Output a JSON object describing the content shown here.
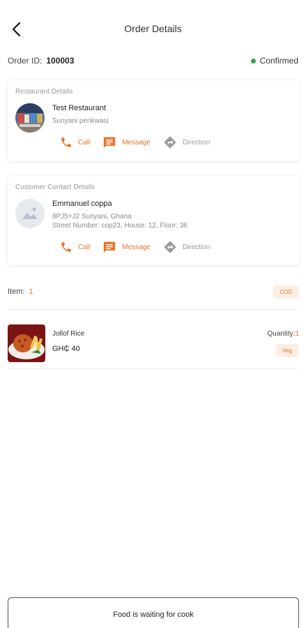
{
  "header": {
    "title": "Order Details"
  },
  "order": {
    "id_label": "Order ID:",
    "id_value": "100003",
    "status": "Confirmed",
    "status_color": "#2eaa3e"
  },
  "restaurant": {
    "section_title": "Restaurant Details",
    "name": "Test Restaurant",
    "address": "Sunyani penkwasi",
    "actions": {
      "call": "Call",
      "message": "Message",
      "direction": "Direction"
    }
  },
  "customer": {
    "section_title": "Customer Contact Details",
    "name": "Emmanuel coppa",
    "address_line1": "8PJ5+J2 Sunyani, Ghana",
    "address_line2": "Street Number: cop23, House: 12, Floor: 36",
    "actions": {
      "call": "Call",
      "message": "Message",
      "direction": "Direction"
    }
  },
  "items_summary": {
    "label": "Item:",
    "count": "1",
    "payment_badge": "COD"
  },
  "items": [
    {
      "name": "Jollof Rice",
      "price": "GH₵ 40",
      "quantity_label": "Quantity:",
      "quantity": "1",
      "tag": "Veg"
    }
  ],
  "footer": {
    "button_label": "Food is waiting for cook"
  },
  "colors": {
    "accent": "#e8742a",
    "accent_bg": "#fdeee4",
    "muted": "#999999"
  }
}
